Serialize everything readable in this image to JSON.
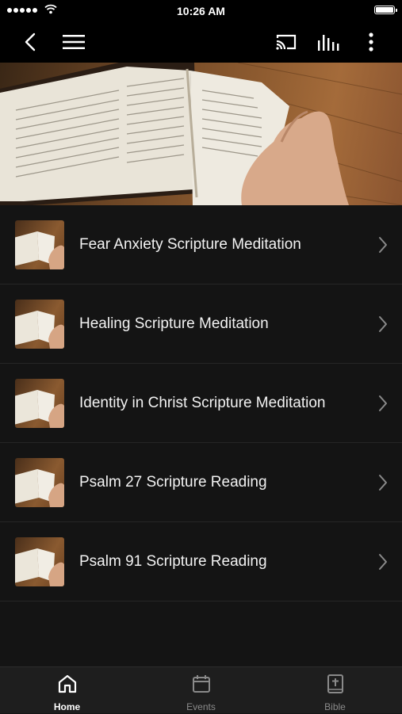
{
  "status_bar": {
    "time": "10:26 AM"
  },
  "toolbar": {
    "back_icon": "chevron-left-icon",
    "menu_icon": "hamburger-menu-icon",
    "cast_icon": "cast-icon",
    "audio_icon": "audio-bars-icon",
    "more_icon": "more-vertical-icon"
  },
  "hero": {
    "image": "open-bible-on-wooden-table"
  },
  "items": [
    {
      "title": "Fear Anxiety Scripture Meditation"
    },
    {
      "title": "Healing Scripture Meditation"
    },
    {
      "title": "Identity in Christ Scripture Meditation"
    },
    {
      "title": "Psalm 27 Scripture Reading"
    },
    {
      "title": "Psalm 91 Scripture Reading"
    }
  ],
  "tabs": [
    {
      "label": "Home",
      "icon": "home-icon",
      "active": true
    },
    {
      "label": "Events",
      "icon": "calendar-icon",
      "active": false
    },
    {
      "label": "Bible",
      "icon": "bible-icon",
      "active": false
    }
  ],
  "colors": {
    "background": "#141414",
    "bar": "#000000",
    "tabbar": "#1e1e1e",
    "active_tab": "#ffffff",
    "inactive_tab": "#8a8a8a"
  }
}
